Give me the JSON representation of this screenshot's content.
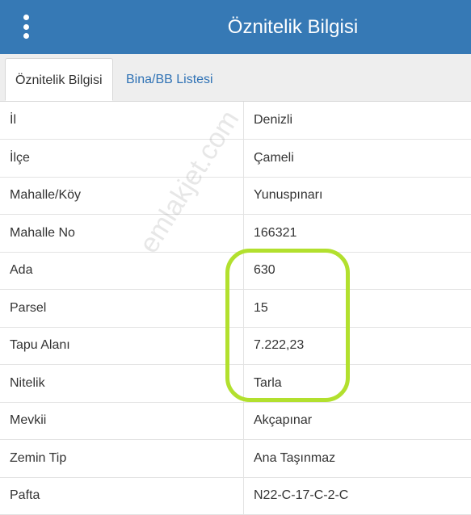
{
  "header": {
    "title": "Öznitelik Bilgisi",
    "menu_icon": "kebab-menu-icon"
  },
  "tabs": [
    {
      "label": "Öznitelik Bilgisi",
      "active": true
    },
    {
      "label": "Bina/BB Listesi",
      "active": false
    }
  ],
  "rows": [
    {
      "key": "İl",
      "value": "Denizli"
    },
    {
      "key": "İlçe",
      "value": "Çameli"
    },
    {
      "key": "Mahalle/Köy",
      "value": "Yunuspınarı"
    },
    {
      "key": "Mahalle No",
      "value": "166321"
    },
    {
      "key": "Ada",
      "value": "630"
    },
    {
      "key": "Parsel",
      "value": "15"
    },
    {
      "key": "Tapu Alanı",
      "value": "7.222,23"
    },
    {
      "key": "Nitelik",
      "value": "Tarla"
    },
    {
      "key": "Mevkii",
      "value": "Akçapınar"
    },
    {
      "key": "Zemin Tip",
      "value": "Ana Taşınmaz"
    },
    {
      "key": "Pafta",
      "value": "N22-C-17-C-2-C"
    }
  ],
  "watermark": "emlakjet.com",
  "colors": {
    "header": "#3679b5",
    "tab_link": "#2f72b5",
    "highlight": "#b2e02e"
  }
}
